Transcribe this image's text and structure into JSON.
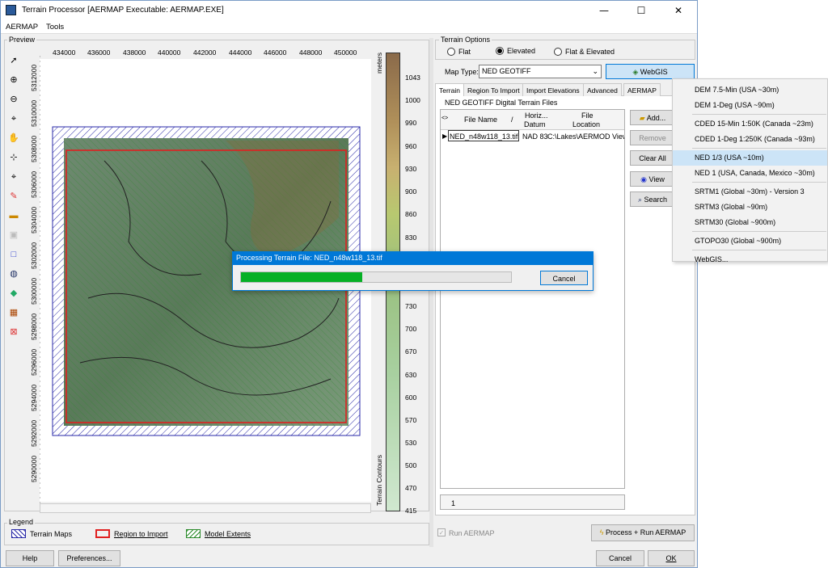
{
  "title": "Terrain Processor [AERMAP Executable: AERMAP.EXE]",
  "window_buttons": {
    "min": "—",
    "max": "☐",
    "close": "✕"
  },
  "menu": [
    "AERMAP",
    "Tools"
  ],
  "preview": {
    "label": "Preview",
    "x_ticks": [
      "434000",
      "436000",
      "438000",
      "440000",
      "442000",
      "444000",
      "446000",
      "448000",
      "450000"
    ],
    "y_ticks": [
      "5312000",
      "5310000",
      "5308000",
      "5306000",
      "5304000",
      "5302000",
      "5300000",
      "5298000",
      "5296000",
      "5294000",
      "5292000",
      "5290000"
    ],
    "units": "meters",
    "contours_label": "Terrain Contours",
    "scale": [
      "1043",
      "1000",
      "990",
      "960",
      "930",
      "900",
      "860",
      "830",
      "730",
      "700",
      "670",
      "630",
      "600",
      "570",
      "530",
      "500",
      "470",
      "415"
    ]
  },
  "legend": {
    "title": "Legend",
    "items": [
      "Terrain Maps",
      "Region to Import",
      "Model Extents"
    ]
  },
  "terrain_options": {
    "title": "Terrain Options",
    "options": [
      "Flat",
      "Elevated",
      "Flat & Elevated"
    ],
    "selected": "Elevated"
  },
  "map_type": {
    "label": "Map Type:",
    "value": "NED GEOTIFF",
    "webgis": "WebGIS"
  },
  "tabs": [
    "Terrain",
    "Region To Import",
    "Import Elevations",
    "Advanced",
    "AERMAP"
  ],
  "files": {
    "group_title": "NED GEOTIFF Digital Terrain Files",
    "headers": {
      "arrows": "<>",
      "name": "File Name",
      "sort": "/",
      "datum1": "Horiz...",
      "datum2": "Datum",
      "loc1": "File",
      "loc2": "Location"
    },
    "row": {
      "name": "NED_n48w118_13.tif",
      "datum": "NAD 83",
      "location": "C:\\Lakes\\AERMOD View"
    },
    "footer_count": "1"
  },
  "side_buttons": [
    "Add...",
    "Remove",
    "Clear All",
    "View",
    "Search"
  ],
  "run_aermap": "Run AERMAP",
  "process_button": "Process + Run AERMAP",
  "bottom": {
    "help": "Help",
    "prefs": "Preferences...",
    "cancel": "Cancel",
    "ok": "OK"
  },
  "progress": {
    "title": "Processing Terrain File: NED_n48w118_13.tif",
    "fraction": 0.45,
    "cancel": "Cancel"
  },
  "dropdown": [
    {
      "label": "DEM 7.5-Min (USA ~30m)"
    },
    {
      "label": "DEM 1-Deg (USA ~90m)",
      "sep": true
    },
    {
      "label": "CDED 15-Min 1:50K (Canada ~23m)"
    },
    {
      "label": "CDED 1-Deg 1:250K (Canada ~93m)",
      "sep": true
    },
    {
      "label": "NED 1/3 (USA ~10m)",
      "selected": true
    },
    {
      "label": "NED 1 (USA, Canada, Mexico ~30m)",
      "sep": true
    },
    {
      "label": "SRTM1 (Global ~30m) - Version 3"
    },
    {
      "label": "SRTM3 (Global ~90m)"
    },
    {
      "label": "SRTM30 (Global ~900m)",
      "sep": true
    },
    {
      "label": "GTOPO30 (Global ~900m)",
      "sep": true
    },
    {
      "label": "WebGIS..."
    }
  ],
  "colors": {
    "accent": "#0078d7",
    "progress": "#06b025",
    "region": "#e02020",
    "selected_menu": "#cce4f7"
  }
}
